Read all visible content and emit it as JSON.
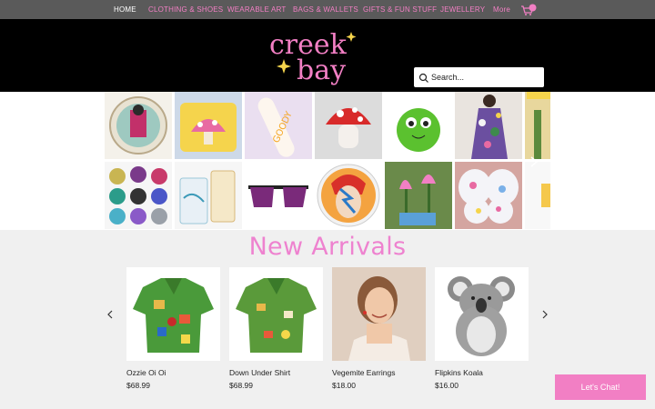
{
  "nav": {
    "items": [
      "HOME",
      "CLOTHING & SHOES",
      "WEARABLE ART",
      "BAGS & WALLETS",
      "GIFTS & FUN STUFF",
      "JEWELLERY",
      "More"
    ],
    "active_index": 0,
    "cart_count": "0"
  },
  "brand": {
    "logo_line1": "creek",
    "logo_line2": "bay",
    "pink": "#f27fc4",
    "yellow": "#f5d44c"
  },
  "search": {
    "placeholder": "Search..."
  },
  "gallery": {
    "row1": [
      "decorative-plate",
      "mushroom-beaded-pouch",
      "goody-bies-keychain",
      "red-mushroom-plush",
      "green-monster-plush",
      "floral-dress",
      "cactus-print"
    ],
    "row2": [
      "glitter-pots",
      "gift-boxes",
      "purple-sunglasses",
      "bowie-plate",
      "tulip-pin",
      "butterfly-dish",
      "yellow-item"
    ]
  },
  "arrivals": {
    "title": "New Arrivals",
    "products": [
      {
        "name": "Ozzie Oi Oi",
        "price": "$68.99"
      },
      {
        "name": "Down Under Shirt",
        "price": "$68.99"
      },
      {
        "name": "Vegemite Earrings",
        "price": "$18.00"
      },
      {
        "name": "Flipkins Koala",
        "price": "$16.00"
      }
    ]
  },
  "chat": {
    "label": "Let's Chat!"
  }
}
